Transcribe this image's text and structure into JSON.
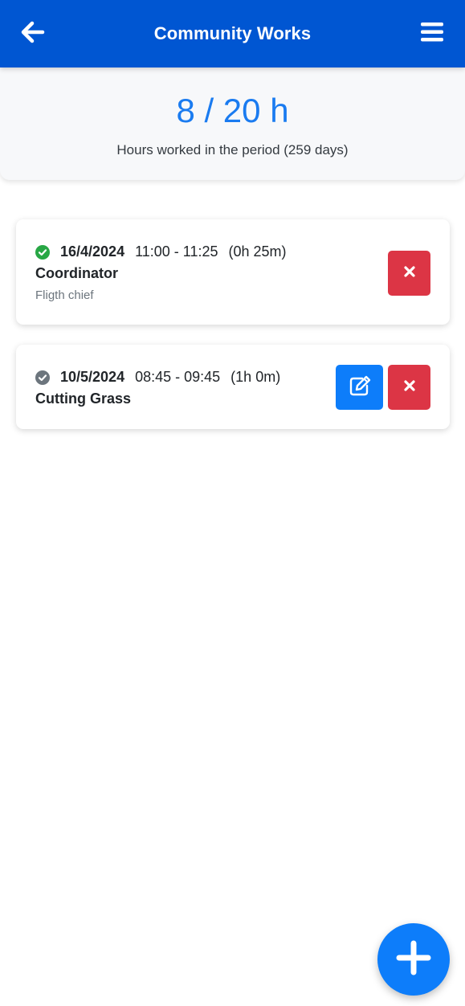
{
  "header": {
    "title": "Community Works",
    "back_icon": "arrow-left-icon",
    "menu_icon": "hamburger-menu-icon",
    "color": "#0056d2"
  },
  "summary": {
    "hours": "8 / 20 h",
    "caption": "Hours worked in the period (259 days)",
    "hours_color": "#1a7bf0"
  },
  "entries": [
    {
      "status": "approved",
      "status_icon": "check-circle-icon",
      "status_color": "#28a745",
      "date": "16/4/2024",
      "time": "11:00 - 11:25",
      "duration": "(0h 25m)",
      "activity": "Coordinator",
      "note": "Fligth chief",
      "actions": [
        "delete"
      ]
    },
    {
      "status": "pending",
      "status_icon": "check-circle-icon",
      "status_color": "#6c757d",
      "date": "10/5/2024",
      "time": "08:45 - 09:45",
      "duration": "(1h 0m)",
      "activity": "Cutting Grass",
      "note": "",
      "actions": [
        "edit",
        "delete"
      ]
    }
  ],
  "colors": {
    "danger": "#dc3545",
    "primary": "#0d7dfa"
  },
  "fab": {
    "icon": "plus-icon"
  }
}
